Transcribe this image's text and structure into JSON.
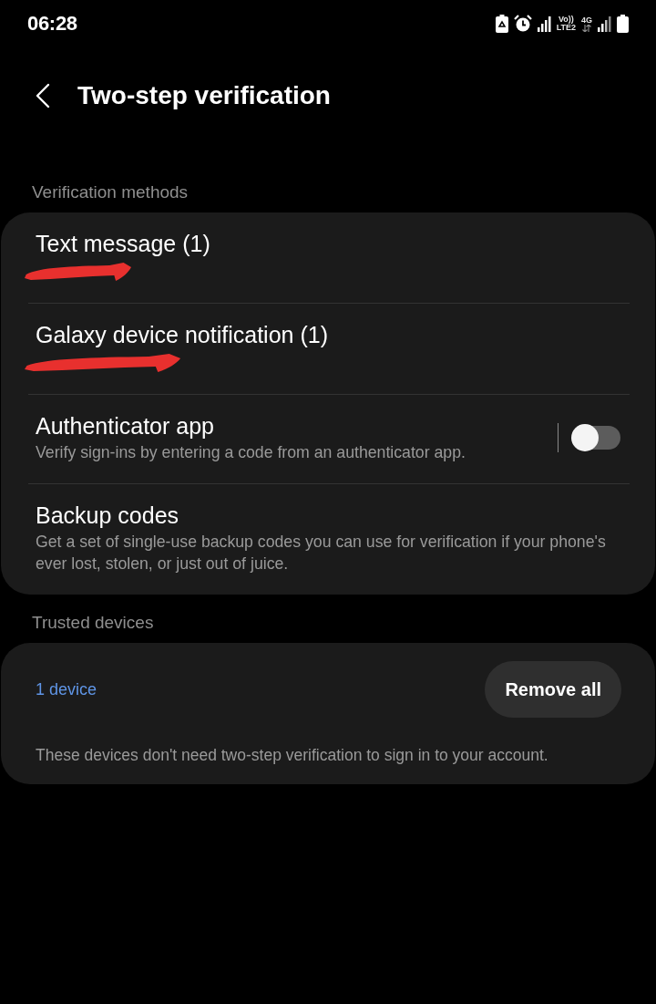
{
  "status_bar": {
    "time": "06:28",
    "sim1_top": "Vo))",
    "sim1_bottom": "LTE2",
    "sim2_type": "4G"
  },
  "header": {
    "title": "Two-step verification"
  },
  "verification_methods": {
    "heading": "Verification methods",
    "items": [
      {
        "kind": "plain",
        "title": "Text message (1)",
        "redacted": true
      },
      {
        "kind": "plain",
        "title": "Galaxy device notification (1)",
        "redacted": true
      },
      {
        "kind": "switch",
        "title": "Authenticator app",
        "subtitle": "Verify sign-ins by entering a code from an authenticator app.",
        "on": false
      },
      {
        "kind": "plain",
        "title": "Backup codes",
        "subtitle": "Get a set of single-use backup codes you can use for verification if your phone's ever lost, stolen, or just out of juice.",
        "redacted": false
      }
    ]
  },
  "trusted_devices": {
    "heading": "Trusted devices",
    "link": "1 device",
    "button": "Remove all",
    "note": "These devices don't need two-step verification to sign in to your account."
  }
}
